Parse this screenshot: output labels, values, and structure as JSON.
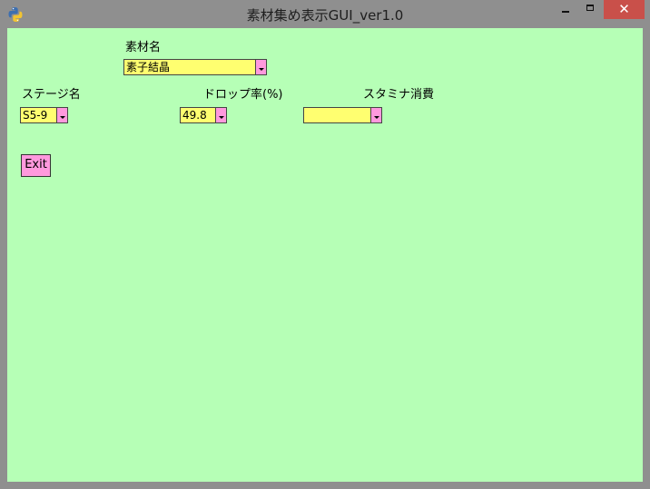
{
  "window": {
    "title": "素材集め表示GUI_ver1.0",
    "icon": "python-icon",
    "controls": {
      "minimize": "minimize-icon",
      "maximize": "maximize-icon",
      "close": "✕"
    }
  },
  "colors": {
    "client_bg": "#b6ffb6",
    "combo_bg": "#ffff70",
    "accent_pink": "#ff99dd",
    "titlebar_bg": "#8f8f8f",
    "close_bg": "#c9504a"
  },
  "form": {
    "material": {
      "label": "素材名",
      "value": "素子結晶"
    },
    "stage": {
      "label": "ステージ名",
      "value": "S5-9"
    },
    "drop_rate": {
      "label": "ドロップ率(%)",
      "value": "49.8"
    },
    "stamina": {
      "label": "スタミナ消費",
      "value": ""
    },
    "exit_label": "Exit"
  }
}
